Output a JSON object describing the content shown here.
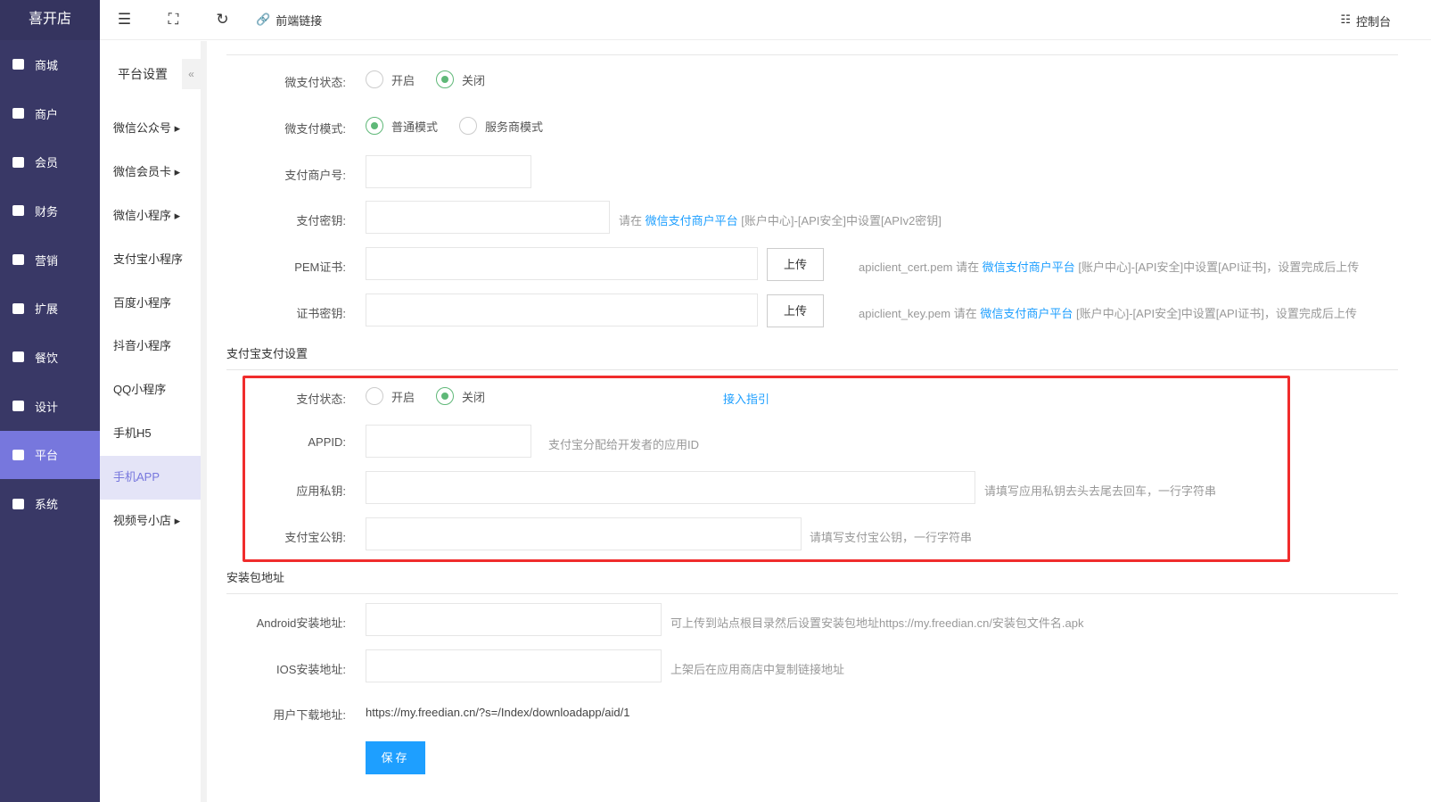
{
  "app": {
    "title": "喜开店"
  },
  "topbar": {
    "front_link": "前端链接",
    "console": "控制台"
  },
  "sidebar": {
    "items": [
      {
        "label": "商城"
      },
      {
        "label": "商户"
      },
      {
        "label": "会员"
      },
      {
        "label": "财务"
      },
      {
        "label": "营销"
      },
      {
        "label": "扩展"
      },
      {
        "label": "餐饮"
      },
      {
        "label": "设计"
      },
      {
        "label": "平台"
      },
      {
        "label": "系统"
      }
    ]
  },
  "submenu": {
    "title": "平台设置",
    "items": [
      {
        "label": "微信公众号 ▸"
      },
      {
        "label": "微信会员卡 ▸"
      },
      {
        "label": "微信小程序 ▸"
      },
      {
        "label": "支付宝小程序"
      },
      {
        "label": "百度小程序"
      },
      {
        "label": "抖音小程序"
      },
      {
        "label": "QQ小程序"
      },
      {
        "label": "手机H5"
      },
      {
        "label": "手机APP"
      },
      {
        "label": "视频号小店 ▸"
      }
    ]
  },
  "wxpay": {
    "status_label": "微支付状态:",
    "on": "开启",
    "off": "关闭",
    "mode_label": "微支付模式:",
    "mode_normal": "普通模式",
    "mode_service": "服务商模式",
    "mchid_label": "支付商户号:",
    "key_label": "支付密钥:",
    "key_hint_pre": "请在",
    "key_hint_link": "微信支付商户平台",
    "key_hint_post": "[账户中心]-[API安全]中设置[APIv2密钥]",
    "pem_label": "PEM证书:",
    "upload": "上传",
    "pem_hint_pre": "apiclient_cert.pem 请在",
    "pem_hint_link": "微信支付商户平台",
    "pem_hint_post": "[账户中心]-[API安全]中设置[API证书]，设置完成后上传",
    "certkey_label": "证书密钥:",
    "certkey_hint_pre": "apiclient_key.pem 请在",
    "certkey_hint_link": "微信支付商户平台",
    "certkey_hint_post": "[账户中心]-[API安全]中设置[API证书]，设置完成后上传"
  },
  "alipay": {
    "section": "支付宝支付设置",
    "status_label": "支付状态:",
    "on": "开启",
    "off": "关闭",
    "guide": "接入指引",
    "appid_label": "APPID:",
    "appid_hint": "支付宝分配给开发者的应用ID",
    "privkey_label": "应用私钥:",
    "privkey_hint": "请填写应用私钥去头去尾去回车，一行字符串",
    "pubkey_label": "支付宝公钥:",
    "pubkey_hint": "请填写支付宝公钥，一行字符串"
  },
  "package": {
    "section": "安装包地址",
    "android_label": "Android安装地址:",
    "android_hint": "可上传到站点根目录然后设置安装包地址https://my.freedian.cn/安装包文件名.apk",
    "ios_label": "IOS安装地址:",
    "ios_hint": "上架后在应用商店中复制链接地址",
    "download_label": "用户下载地址:",
    "download_url": "https://my.freedian.cn/?s=/Index/downloadapp/aid/1"
  },
  "save": "保存"
}
